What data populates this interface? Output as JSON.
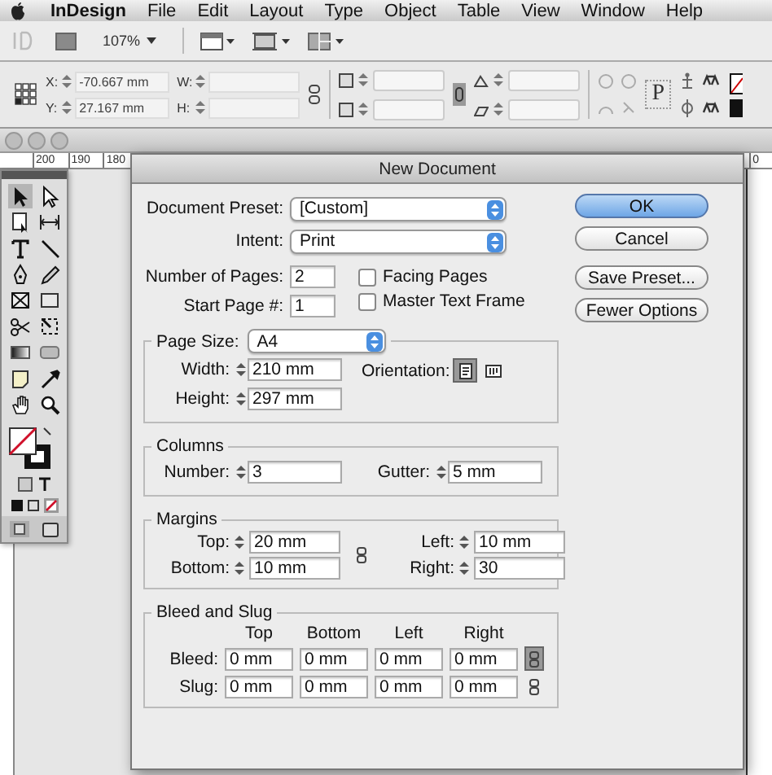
{
  "menu_bar": {
    "app_name": "InDesign",
    "items": [
      "File",
      "Edit",
      "Layout",
      "Type",
      "Object",
      "Table",
      "View",
      "Window",
      "Help"
    ]
  },
  "app_bar": {
    "zoom": "107%"
  },
  "control_panel": {
    "x_label": "X:",
    "x_value": "-70.667 mm",
    "y_label": "Y:",
    "y_value": "27.167 mm",
    "w_label": "W:",
    "h_label": "H:",
    "frame_letter": "P"
  },
  "rulers": {
    "top_labels": [
      "200",
      "190",
      "180"
    ],
    "right_label": "0"
  },
  "dialog": {
    "title": "New Document",
    "preset": {
      "label": "Document Preset:",
      "value": "[Custom]"
    },
    "intent": {
      "label": "Intent:",
      "value": "Print"
    },
    "number_of_pages": {
      "label": "Number of Pages:",
      "value": "2"
    },
    "start_page": {
      "label": "Start Page #:",
      "value": "1"
    },
    "options": [
      {
        "label": "Facing Pages",
        "checked": false
      },
      {
        "label": "Master Text Frame",
        "checked": false
      }
    ],
    "page_size": {
      "label": "Page Size:",
      "value": "A4",
      "width": {
        "label": "Width:",
        "value": "210 mm"
      },
      "height": {
        "label": "Height:",
        "value": "297 mm"
      },
      "orientation_label": "Orientation:",
      "orientations": [
        {
          "kind": "portrait",
          "selected": true
        },
        {
          "kind": "landscape",
          "selected": false
        }
      ]
    },
    "columns": {
      "title": "Columns",
      "number": {
        "label": "Number:",
        "value": "3"
      },
      "gutter": {
        "label": "Gutter:",
        "value": "5 mm"
      }
    },
    "margins": {
      "title": "Margins",
      "linked": false,
      "fields": [
        {
          "label": "Top:",
          "value": "20 mm"
        },
        {
          "label": "Left:",
          "value": "10 mm"
        },
        {
          "label": "Bottom:",
          "value": "10 mm"
        },
        {
          "label": "Right:",
          "value": "30"
        }
      ]
    },
    "bleed_slug": {
      "title": "Bleed and Slug",
      "headers": [
        "Top",
        "Bottom",
        "Left",
        "Right"
      ],
      "rows": [
        {
          "label": "Bleed:",
          "values": [
            "0 mm",
            "0 mm",
            "0 mm",
            "0 mm"
          ],
          "linked": true
        },
        {
          "label": "Slug:",
          "values": [
            "0 mm",
            "0 mm",
            "0 mm",
            "0 mm"
          ],
          "linked": false
        }
      ]
    },
    "buttons": [
      {
        "label": "OK",
        "default": true
      },
      {
        "label": "Cancel",
        "default": false
      },
      {
        "label": "Save Preset...",
        "default": false
      },
      {
        "label": "Fewer Options",
        "default": false
      }
    ]
  }
}
